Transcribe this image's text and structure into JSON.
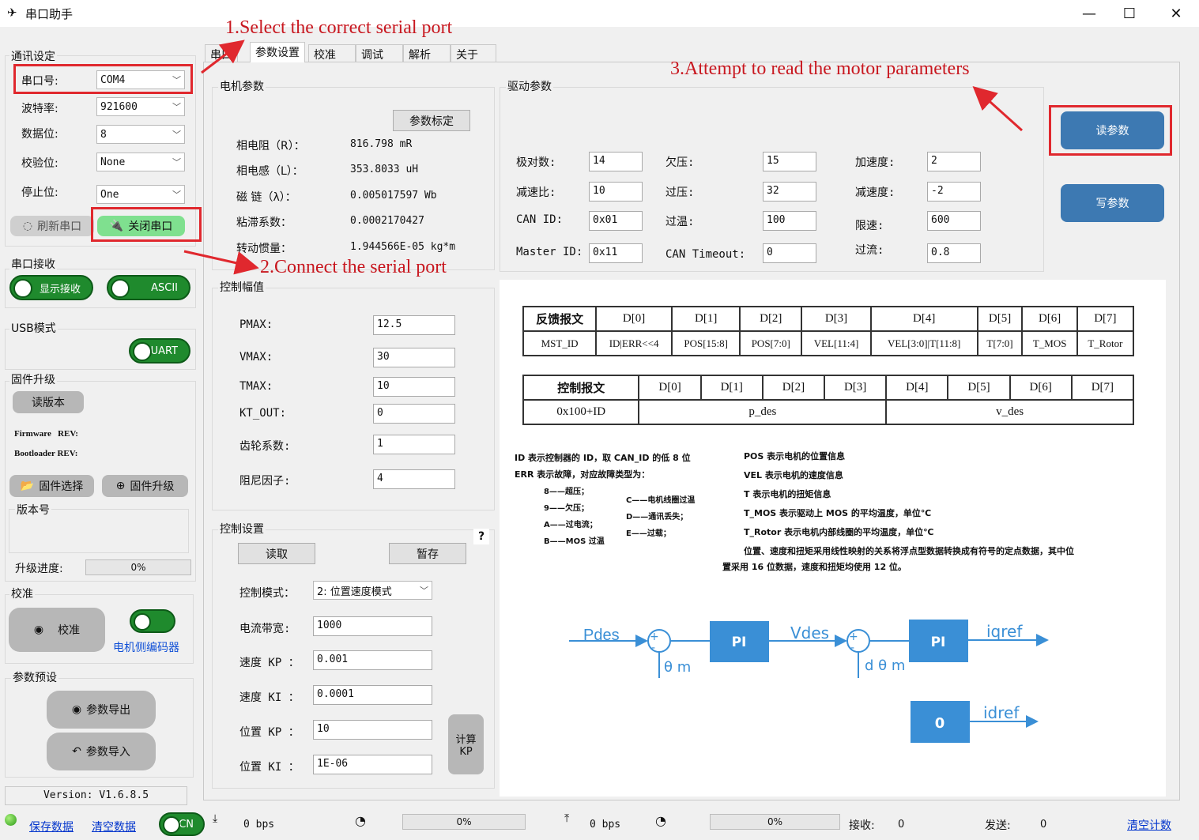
{
  "window": {
    "title": "串口助手",
    "min": "—",
    "max": "☐",
    "close": "✕"
  },
  "comm": {
    "group": "通讯设定",
    "port_label": "串口号:",
    "port_value": "COM4",
    "baud_label": "波特率:",
    "baud_value": "921600",
    "databits_label": "数据位:",
    "databits_value": "8",
    "parity_label": "校验位:",
    "parity_value": "None",
    "stopbits_label": "停止位:",
    "stopbits_value": "One",
    "refresh_label": "刷新串口",
    "close_label": "关闭串口"
  },
  "receive": {
    "group": "串口接收",
    "show_label": "显示接收",
    "ascii_label": "ASCII"
  },
  "usb": {
    "group": "USB模式",
    "uart_label": "UART"
  },
  "firmware": {
    "group": "固件升级",
    "read_version": "读版本",
    "firmware_rev": "Firmware   REV:",
    "bootloader_rev": "Bootloader REV:",
    "select_label": "固件选择",
    "upgrade_label": "固件升级",
    "version_label": "版本号",
    "progress_label": "升级进度:",
    "progress_value": "0%",
    "progress_fraction": 0
  },
  "calib": {
    "group": "校准",
    "button": "校准",
    "encoder_label": "电机侧编码器"
  },
  "preset": {
    "group": "参数预设",
    "export_label": "参数导出",
    "import_label": "参数导入"
  },
  "version_text": "Version: V1.6.8.5",
  "tabs": [
    "串口",
    "参数设置",
    "校准",
    "调试",
    "解析",
    "关于"
  ],
  "motor": {
    "group": "电机参数",
    "calib_btn": "参数标定",
    "rows": [
      {
        "label": "相电阻（R）：",
        "value": "816.798 mR"
      },
      {
        "label": "相电感（L）：",
        "value": "353.8033 uH"
      },
      {
        "label": "磁 链（λ）：",
        "value": "0.005017597 Wb"
      },
      {
        "label": "粘滞系数：",
        "value": "0.0002170427"
      },
      {
        "label": "转动惯量：",
        "value": "1.944566E-05 kg*m"
      }
    ]
  },
  "drive": {
    "group": "驱动参数",
    "col1": [
      {
        "label": "极对数:",
        "value": "14"
      },
      {
        "label": "减速比:",
        "value": "10"
      },
      {
        "label": "CAN ID:",
        "value": "0x01"
      },
      {
        "label": "Master ID:",
        "value": "0x11"
      }
    ],
    "col2": [
      {
        "label": "欠压:",
        "value": "15"
      },
      {
        "label": "过压:",
        "value": "32"
      },
      {
        "label": "过温:",
        "value": "100"
      },
      {
        "label": "CAN Timeout:",
        "value": "0"
      }
    ],
    "col3": [
      {
        "label": "加速度:",
        "value": "2"
      },
      {
        "label": "减速度:",
        "value": "-2"
      },
      {
        "label": "限速:",
        "value": "600"
      },
      {
        "label": "过流:",
        "value": "0.8"
      }
    ]
  },
  "read_params": "读参数",
  "write_params": "写参数",
  "limits": {
    "group": "控制幅值",
    "rows": [
      {
        "label": "PMAX:",
        "value": "12.5"
      },
      {
        "label": "VMAX:",
        "value": "30"
      },
      {
        "label": "TMAX:",
        "value": "10"
      },
      {
        "label": "KT_OUT:",
        "value": "0"
      },
      {
        "label": "齿轮系数:",
        "value": "1"
      },
      {
        "label": "阻尼因子:",
        "value": "4"
      }
    ]
  },
  "control": {
    "group": "控制设置",
    "help": "?",
    "read_btn": "读取",
    "save_btn": "暂存",
    "mode_label": "控制模式：",
    "mode_value": "2: 位置速度模式",
    "rows": [
      {
        "label": "电流带宽:",
        "value": "1000"
      },
      {
        "label": "速度 KP ：",
        "value": "0.001"
      },
      {
        "label": "速度 KI ：",
        "value": "0.0001"
      },
      {
        "label": "位置 KP ：",
        "value": "10"
      },
      {
        "label": "位置 KI ：",
        "value": "1E-06"
      }
    ],
    "calc_btn": "计算KP"
  },
  "feedback_table": {
    "header": [
      "反馈报文",
      "D[0]",
      "D[1]",
      "D[2]",
      "D[3]",
      "D[4]",
      "D[5]",
      "D[6]",
      "D[7]"
    ],
    "row": [
      "MST_ID",
      "ID|ERR<<4",
      "POS[15:8]",
      "POS[7:0]",
      "VEL[11:4]",
      "VEL[3:0]|T[11:8]",
      "T[7:0]",
      "T_MOS",
      "T_Rotor"
    ]
  },
  "control_table": {
    "header": [
      "控制报文",
      "D[0]",
      "D[1]",
      "D[2]",
      "D[3]",
      "D[4]",
      "D[5]",
      "D[6]",
      "D[7]"
    ],
    "row": [
      "0x100+ID",
      "p_des",
      "v_des"
    ]
  },
  "notes_left": [
    "ID 表示控制器的 ID，取 CAN_ID 的低 8 位",
    "ERR 表示故障，对应故障类型为：",
    "8——超压；",
    "9——欠压；",
    "A——过电流；",
    "B——MOS 过温",
    "C——电机线圈过温",
    "D——通讯丢失；",
    "E——过载；"
  ],
  "notes_right": [
    "POS 表示电机的位置信息",
    "VEL 表示电机的速度信息",
    "T 表示电机的扭矩信息",
    "T_MOS 表示驱动上 MOS 的平均温度，单位℃",
    "T_Rotor 表示电机内部线圈的平均温度，单位℃",
    "位置、速度和扭矩采用线性映射的关系将浮点型数据转换成有符号的定点数据，其中位",
    "置采用 16 位数据，速度和扭矩均使用 12 位。"
  ],
  "diagram": {
    "pdes": "Pdes",
    "pi1": "PI",
    "vdes": "Vdes",
    "pi2": "PI",
    "iqref": "iqref",
    "theta": "θ m",
    "dtheta": "d θ m",
    "zero": "0",
    "idref": "idref",
    "plus1": "+",
    "minus1": "-",
    "plus2": "+",
    "minus2": "-"
  },
  "annotations": {
    "a1": "1.Select the correct serial port",
    "a2": "2.Connect the serial port",
    "a3": "3.Attempt to read the motor parameters"
  },
  "statusbar": {
    "save": "保存数据",
    "clear": "清空数据",
    "cn": "CN",
    "rx_bps": "0 bps",
    "rx_pct": "0%",
    "tx_bps": "0 bps",
    "tx_pct": "0%",
    "recv_label": "接收:",
    "recv_value": "0",
    "send_label": "发送:",
    "send_value": "0",
    "clear_count": "清空计数"
  },
  "colors": {
    "accent_blue": "#3d79b2",
    "toggle_green": "#1f8a2d",
    "annotation_red": "#e0282e",
    "diagram_blue": "#3a8fd6"
  }
}
